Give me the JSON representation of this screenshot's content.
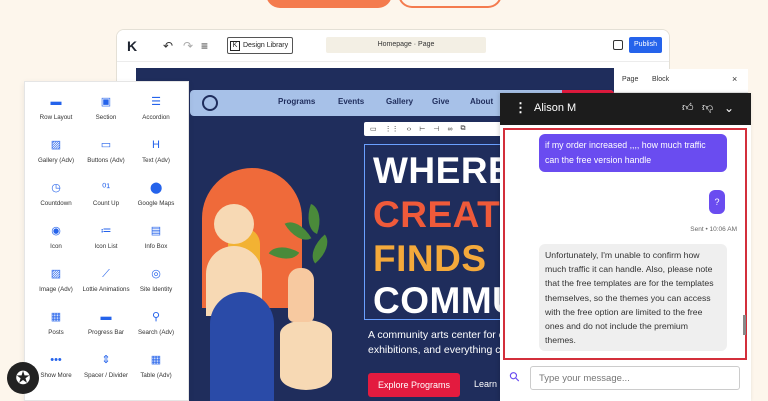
{
  "editor": {
    "design_library_label": "Design Library",
    "page_title": "Homepage · Page",
    "publish_label": "Publish"
  },
  "site": {
    "nav_items": [
      "Programs",
      "Events",
      "Gallery",
      "Give",
      "About"
    ],
    "headline": [
      "WHERE",
      "CREATI",
      "FINDS",
      "COMMU"
    ],
    "subtext_lines": [
      "A community arts center for c",
      "exhibitions, and everything cr"
    ],
    "cta_primary": "Explore Programs",
    "cta_secondary": "Learn"
  },
  "widgets": [
    {
      "label": "Row Layout",
      "icon": "row-layout-icon",
      "glyph": "▬"
    },
    {
      "label": "Section",
      "icon": "section-icon",
      "glyph": "▣"
    },
    {
      "label": "Accordion",
      "icon": "accordion-icon",
      "glyph": "☰"
    },
    {
      "label": "Gallery (Adv)",
      "icon": "gallery-icon",
      "glyph": "▨"
    },
    {
      "label": "Buttons (Adv)",
      "icon": "buttons-icon",
      "glyph": "▭"
    },
    {
      "label": "Text (Adv)",
      "icon": "text-icon",
      "glyph": "H"
    },
    {
      "label": "Countdown",
      "icon": "countdown-icon",
      "glyph": "◷"
    },
    {
      "label": "Count Up",
      "icon": "count-up-icon",
      "glyph": "⁰¹"
    },
    {
      "label": "Google Maps",
      "icon": "map-pin-icon",
      "glyph": "⬤"
    },
    {
      "label": "Icon",
      "icon": "icon-widget-icon",
      "glyph": "◉"
    },
    {
      "label": "Icon List",
      "icon": "icon-list-icon",
      "glyph": "≔"
    },
    {
      "label": "Info Box",
      "icon": "info-box-icon",
      "glyph": "▤"
    },
    {
      "label": "Image (Adv)",
      "icon": "image-icon",
      "glyph": "▨"
    },
    {
      "label": "Lottie Animations",
      "icon": "lottie-icon",
      "glyph": "⟋"
    },
    {
      "label": "Site Identity",
      "icon": "site-identity-icon",
      "glyph": "◎"
    },
    {
      "label": "Posts",
      "icon": "posts-icon",
      "glyph": "▦"
    },
    {
      "label": "Progress Bar",
      "icon": "progress-bar-icon",
      "glyph": "▬"
    },
    {
      "label": "Search (Adv)",
      "icon": "search-icon",
      "glyph": "⚲"
    },
    {
      "label": "Show More",
      "icon": "show-more-icon",
      "glyph": "•••"
    },
    {
      "label": "Spacer / Divider",
      "icon": "spacer-icon",
      "glyph": "⇕"
    },
    {
      "label": "Table (Adv)",
      "icon": "table-icon",
      "glyph": "▦"
    }
  ],
  "side_panel": {
    "tab_page": "Page",
    "tab_block": "Block",
    "close": "×"
  },
  "chat": {
    "agent_name": "Alison M",
    "messages": {
      "out_1": "if my order increased ,,,, how much traffic can the free version handle",
      "out_2": "?",
      "meta": "Sent • 10:06 AM",
      "in_1": "Unfortunately, I'm unable to confirm how much traffic it can handle. Also, please note that the free templates are for the templates themselves, so the themes you can access with the free option are limited to the free ones and do not include the premium themes."
    },
    "input_placeholder": "Type your message..."
  },
  "colors": {
    "accent": "#2563eb",
    "chat_purple": "#6a4cf0",
    "highlight_red": "#d32f3b",
    "canvas_navy": "#1f2d5c"
  }
}
